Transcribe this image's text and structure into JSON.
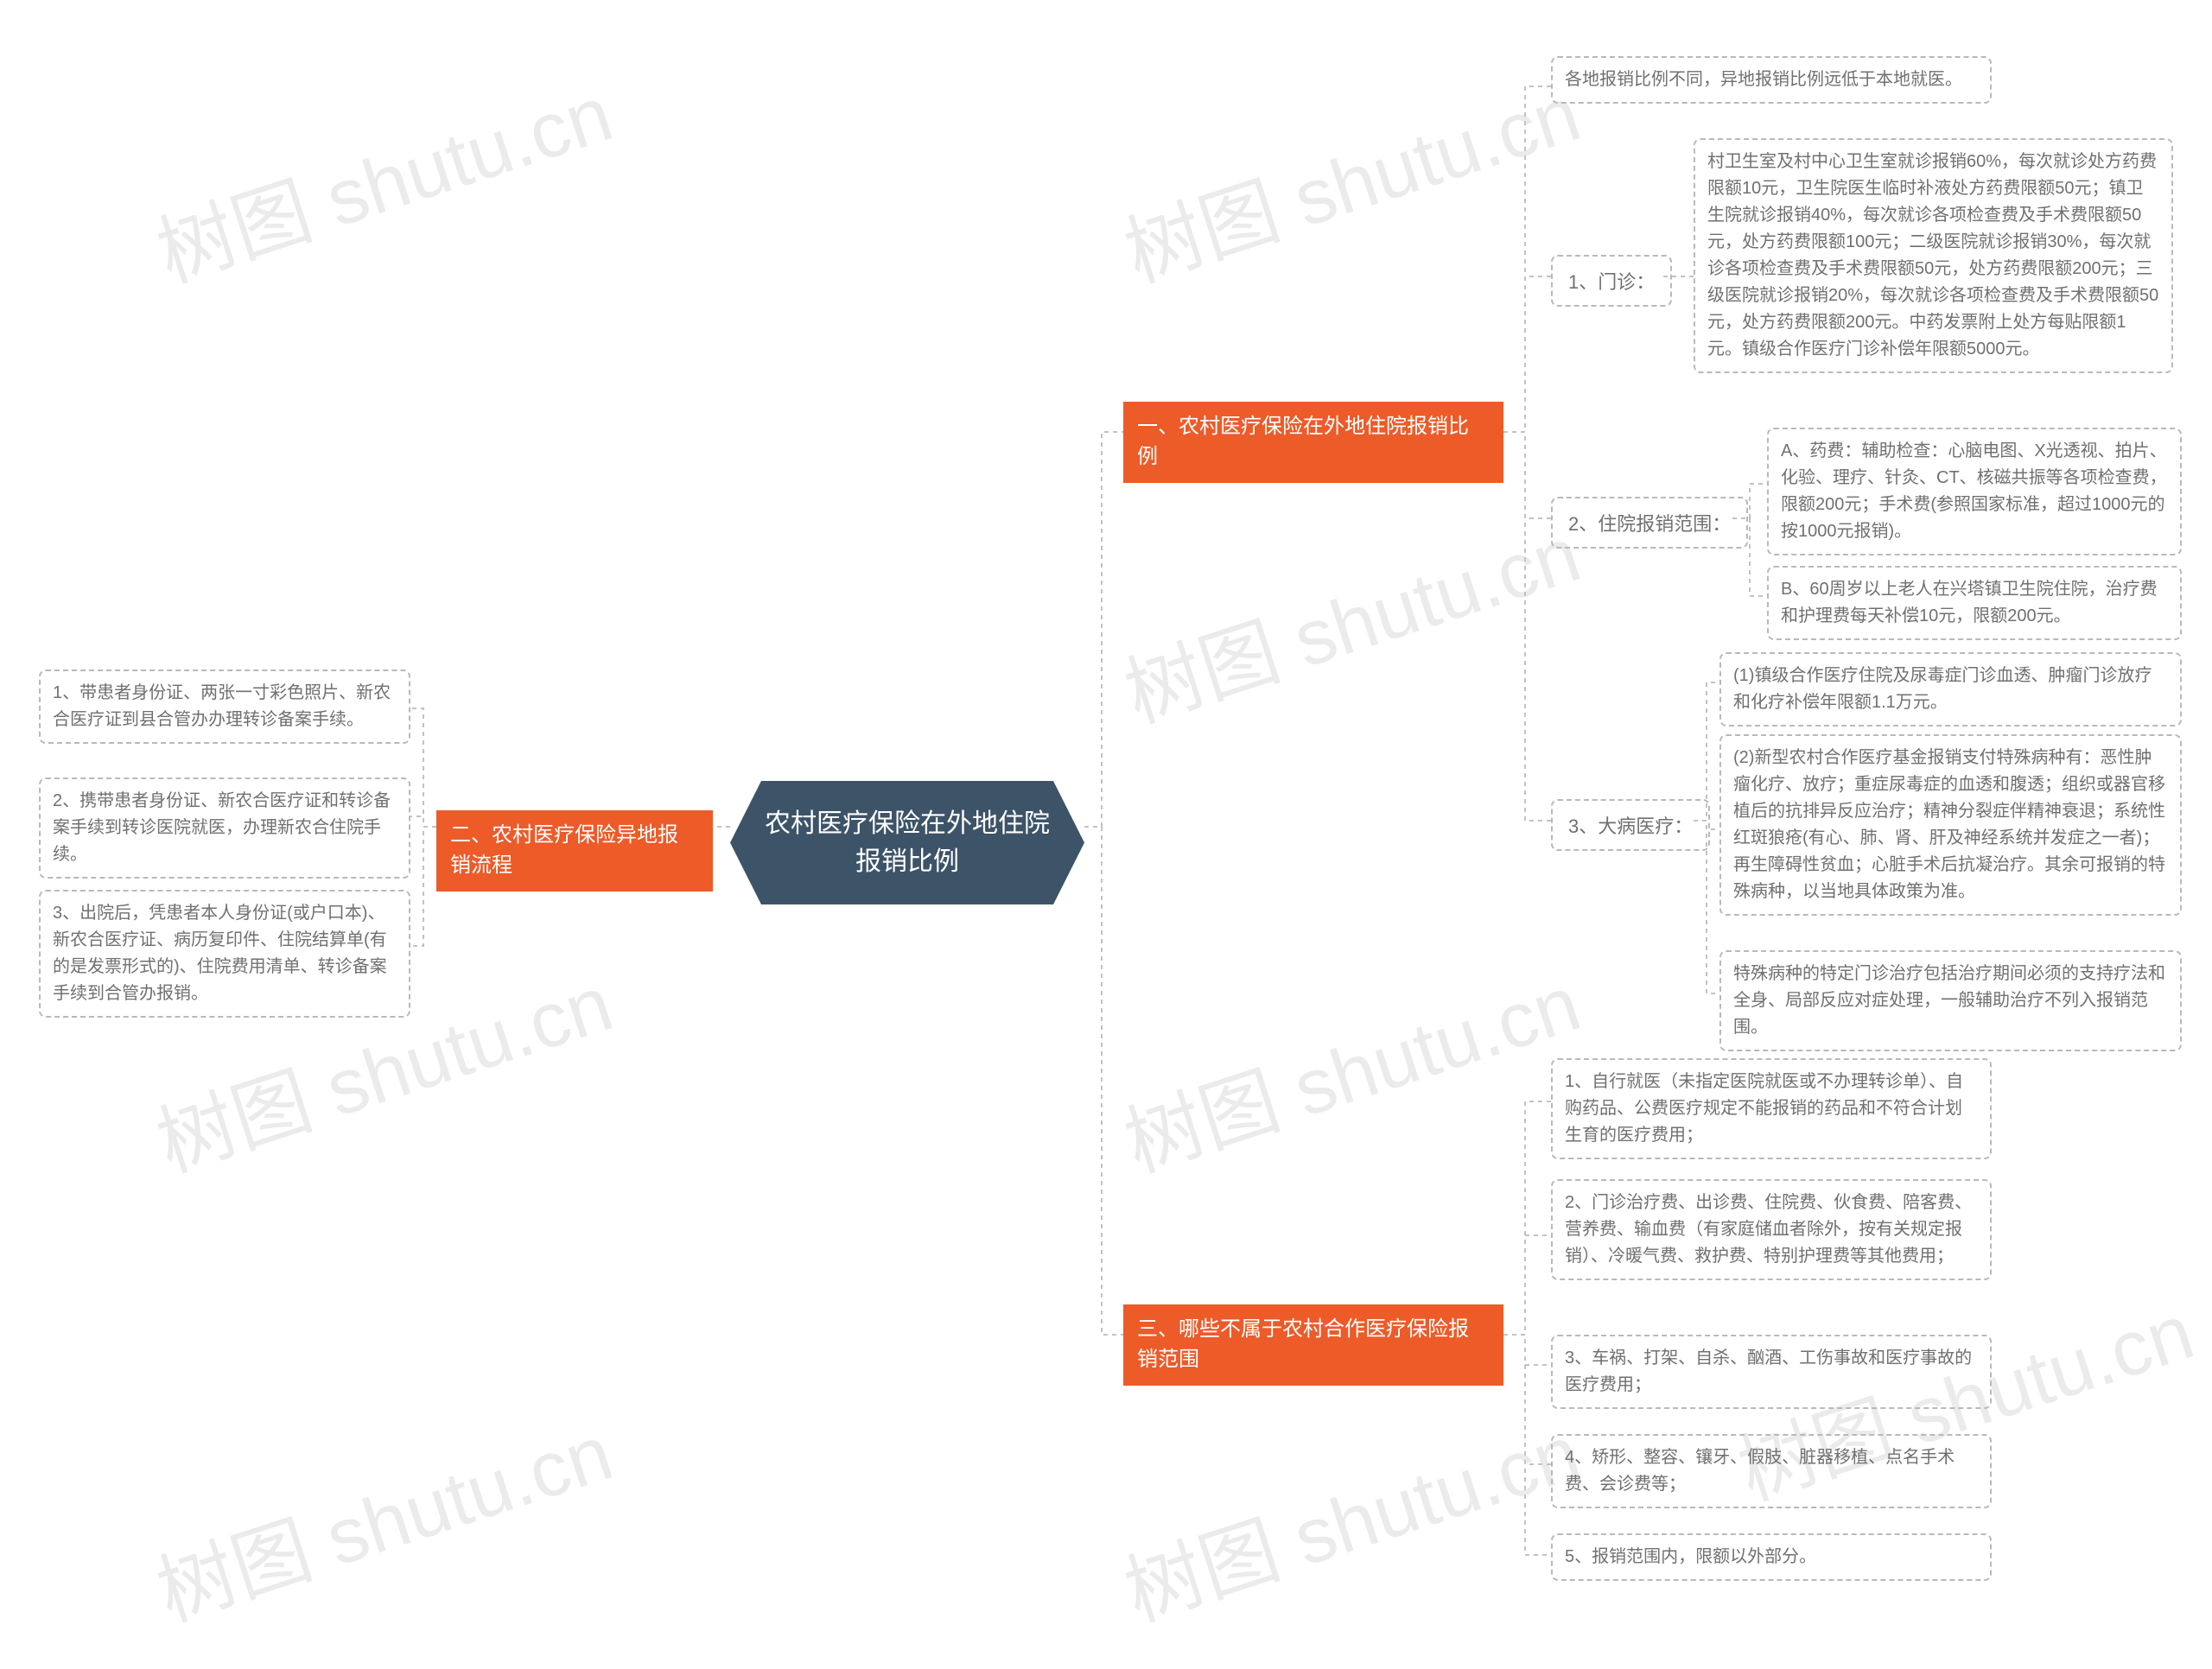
{
  "root": "农村医疗保险在外地住院报销比例",
  "watermark": "树图 shutu.cn",
  "section1": {
    "title": "一、农村医疗保险在外地住院报销比例",
    "intro": "各地报销比例不同，异地报销比例远低于本地就医。",
    "sub1": {
      "label": "1、门诊：",
      "text": "村卫生室及村中心卫生室就诊报销60%，每次就诊处方药费限额10元，卫生院医生临时补液处方药费限额50元；镇卫生院就诊报销40%，每次就诊各项检查费及手术费限额50元，处方药费限额100元；二级医院就诊报销30%，每次就诊各项检查费及手术费限额50元，处方药费限额200元；三级医院就诊报销20%，每次就诊各项检查费及手术费限额50元，处方药费限额200元。中药发票附上处方每贴限额1元。镇级合作医疗门诊补偿年限额5000元。"
    },
    "sub2": {
      "label": "2、住院报销范围：",
      "a": "A、药费：辅助检查：心脑电图、X光透视、拍片、化验、理疗、针灸、CT、核磁共振等各项检查费，限额200元；手术费(参照国家标准，超过1000元的按1000元报销)。",
      "b": "B、60周岁以上老人在兴塔镇卫生院住院，治疗费和护理费每天补偿10元，限额200元。"
    },
    "sub3": {
      "label": "3、大病医疗：",
      "a": "(1)镇级合作医疗住院及尿毒症门诊血透、肿瘤门诊放疗和化疗补偿年限额1.1万元。",
      "b": "(2)新型农村合作医疗基金报销支付特殊病种有：恶性肿瘤化疗、放疗；重症尿毒症的血透和腹透；组织或器官移植后的抗排异反应治疗；精神分裂症伴精神衰退；系统性红斑狼疮(有心、肺、肾、肝及神经系统并发症之一者)；再生障碍性贫血；心脏手术后抗凝治疗。其余可报销的特殊病种，以当地具体政策为准。",
      "c": "特殊病种的特定门诊治疗包括治疗期间必须的支持疗法和全身、局部反应对症处理，一般辅助治疗不列入报销范围。"
    }
  },
  "section2": {
    "title": "二、农村医疗保险异地报销流程",
    "items": [
      "1、带患者身份证、两张一寸彩色照片、新农合医疗证到县合管办办理转诊备案手续。",
      "2、携带患者身份证、新农合医疗证和转诊备案手续到转诊医院就医，办理新农合住院手续。",
      "3、出院后，凭患者本人身份证(或户口本)、新农合医疗证、病历复印件、住院结算单(有的是发票形式的)、住院费用清单、转诊备案手续到合管办报销。"
    ]
  },
  "section3": {
    "title": "三、哪些不属于农村合作医疗保险报销范围",
    "items": [
      "1、自行就医（未指定医院就医或不办理转诊单）、自购药品、公费医疗规定不能报销的药品和不符合计划生育的医疗费用；",
      "2、门诊治疗费、出诊费、住院费、伙食费、陪客费、营养费、输血费（有家庭储血者除外，按有关规定报销）、冷暖气费、救护费、特别护理费等其他费用；",
      "3、车祸、打架、自杀、酗酒、工伤事故和医疗事故的医疗费用；",
      "4、矫形、整容、镶牙、假肢、脏器移植、点名手术费、会诊费等；",
      "5、报销范围内，限额以外部分。"
    ]
  }
}
